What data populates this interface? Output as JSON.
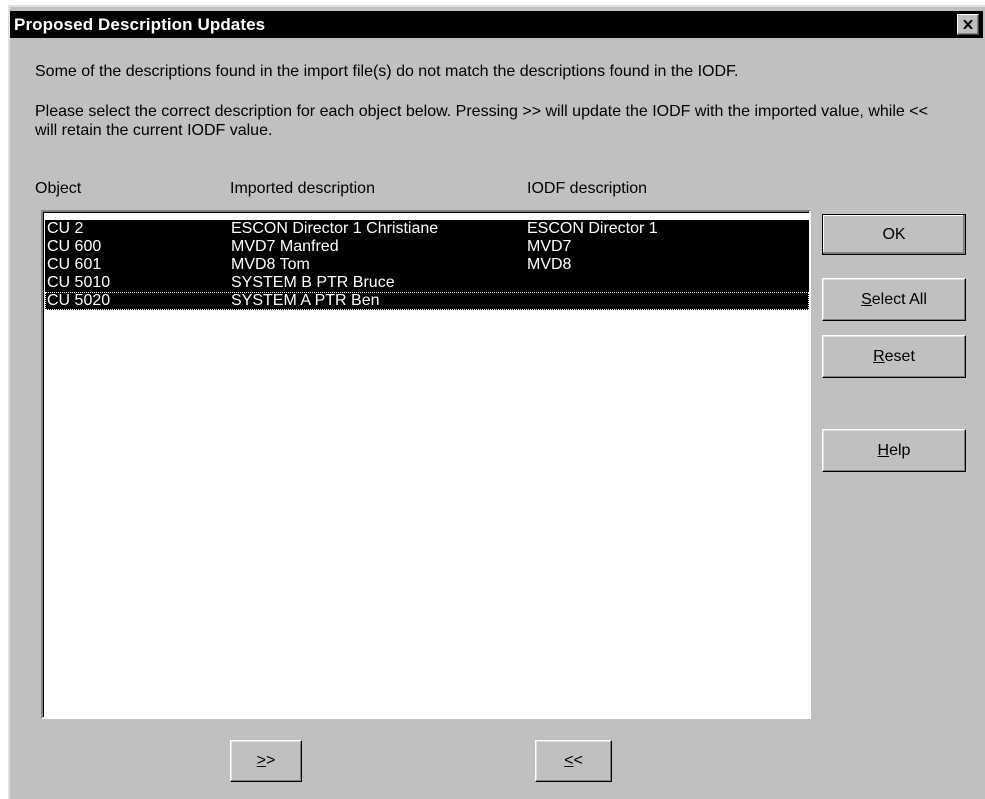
{
  "window": {
    "title": "Proposed Description Updates"
  },
  "message": {
    "line1": "Some of the descriptions found in the import file(s) do not match the descriptions found in the IODF.",
    "line2": "Please select the correct description for each object below.  Pressing >> will update the IODF with the imported value, while << will retain the current IODF value."
  },
  "table": {
    "columns": [
      "Object",
      "Imported description",
      "IODF description"
    ],
    "rows": [
      {
        "object": "CU 2",
        "imported": "ESCON Director 1 Christiane",
        "iodf": "ESCON Director 1",
        "selected": true
      },
      {
        "object": "CU 600",
        "imported": "MVD7 Manfred",
        "iodf": "MVD7",
        "selected": true
      },
      {
        "object": "CU 601",
        "imported": "MVD8 Tom",
        "iodf": "MVD8",
        "selected": true
      },
      {
        "object": "CU 5010",
        "imported": "SYSTEM B PTR Bruce",
        "iodf": "",
        "selected": true
      },
      {
        "object": "CU 5020",
        "imported": "SYSTEM A PTR Ben",
        "iodf": "",
        "selected": true,
        "focused": true
      }
    ]
  },
  "buttons": {
    "ok": "OK",
    "select_all": {
      "mnemonic": "S",
      "rest": "elect All"
    },
    "reset": {
      "mnemonic": "R",
      "rest": "eset"
    },
    "help": {
      "mnemonic": "H",
      "rest": "elp"
    },
    "update": {
      "mnemonic": ">",
      "rest": ">"
    },
    "retain": {
      "mnemonic": "<",
      "rest": "<"
    }
  },
  "icons": {
    "close": "close-icon"
  }
}
